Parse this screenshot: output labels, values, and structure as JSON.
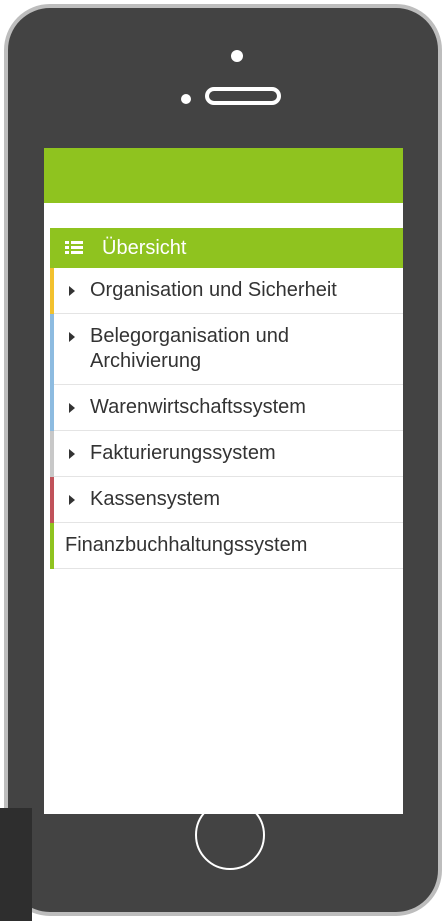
{
  "nav": {
    "active": {
      "label": "Übersicht",
      "icon": "list-icon"
    },
    "items": [
      {
        "label": "Organisation und Sicherheit",
        "color": "#f2c12e",
        "expandable": true
      },
      {
        "label": "Belegorganisation und Archivierung",
        "color": "#8dbbe0",
        "expandable": true
      },
      {
        "label": "Warenwirtschaftssystem",
        "color": "#8dbbe0",
        "expandable": true
      },
      {
        "label": "Fakturierungssystem",
        "color": "#c8c8c8",
        "expandable": true
      },
      {
        "label": "Kassensystem",
        "color": "#c0525a",
        "expandable": true
      },
      {
        "label": "Finanzbuchhaltungssystem",
        "color": "#8fc31f",
        "expandable": false
      }
    ]
  },
  "colors": {
    "accent": "#8fc31f",
    "device_body": "#434343",
    "device_border": "#bdbdbd"
  }
}
